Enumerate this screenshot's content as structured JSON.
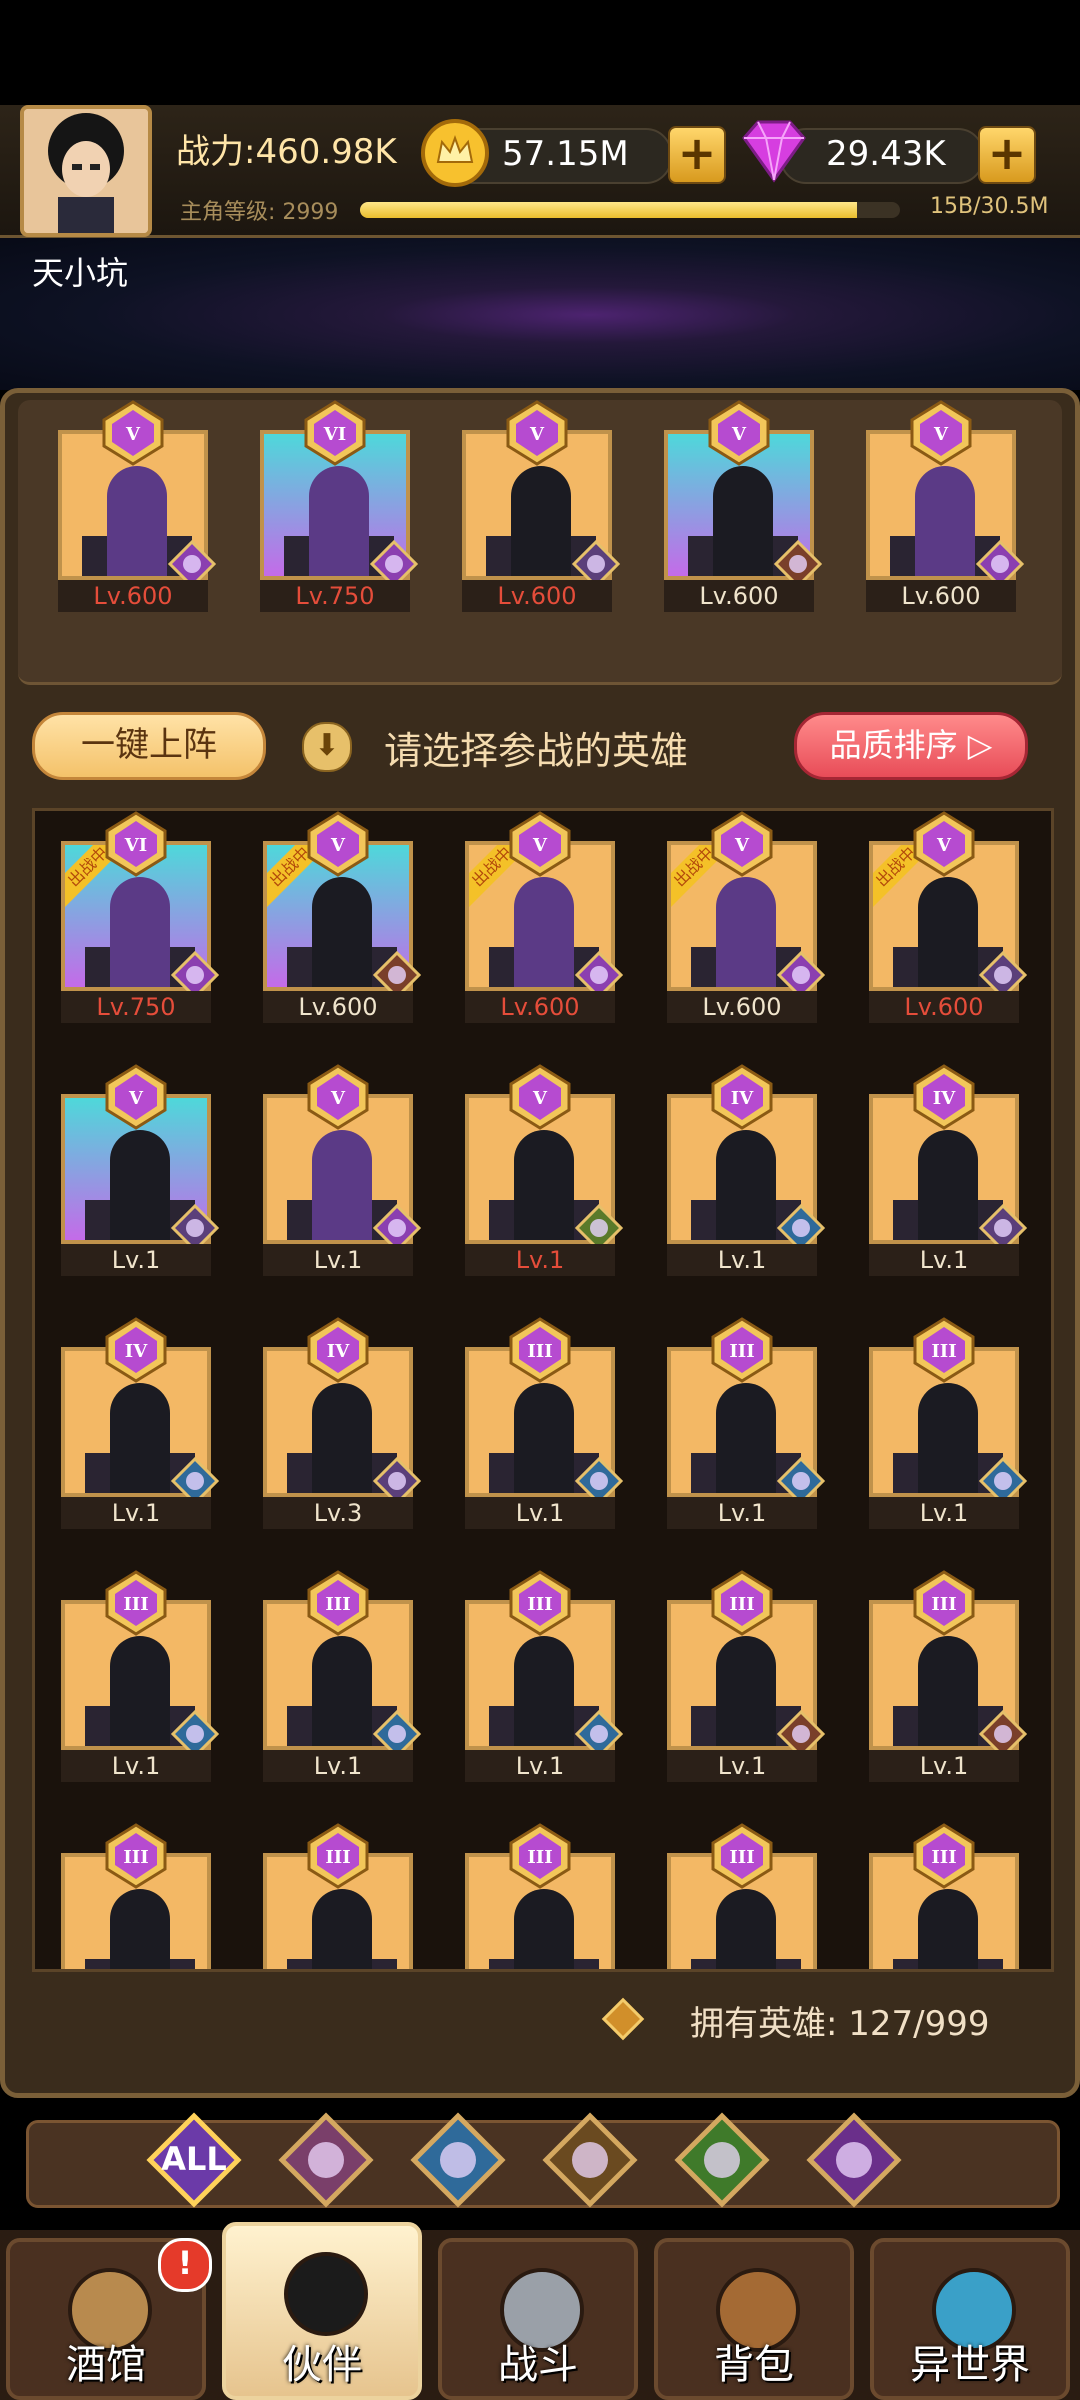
{
  "header": {
    "power": "战力:460.98K",
    "gold": "57.15M",
    "gems": "29.43K",
    "level_label": "主角等级: 2999",
    "level_progress_text": "15B/30.5M",
    "level_fill_fraction": 0.92,
    "player_name": "天小坑"
  },
  "team": [
    {
      "rank": "V",
      "level": "Lv.600",
      "level_color": "red",
      "bg": "gold",
      "faction": "demon"
    },
    {
      "rank": "VI",
      "level": "Lv.750",
      "level_color": "red",
      "bg": "teal",
      "faction": "demon"
    },
    {
      "rank": "V",
      "level": "Lv.600",
      "level_color": "red",
      "bg": "gold",
      "faction": "crown"
    },
    {
      "rank": "V",
      "level": "Lv.600",
      "level_color": "white",
      "bg": "teal",
      "faction": "lion"
    },
    {
      "rank": "V",
      "level": "Lv.600",
      "level_color": "white",
      "bg": "gold",
      "faction": "demon"
    }
  ],
  "actions": {
    "one_key": "一键上阵",
    "hint": "请选择参战的英雄",
    "sort": "品质排序"
  },
  "grid": [
    {
      "rank": "VI",
      "level": "Lv.750",
      "level_color": "red",
      "bg": "teal",
      "tag": "出战中",
      "faction": "demon"
    },
    {
      "rank": "V",
      "level": "Lv.600",
      "level_color": "white",
      "bg": "teal",
      "tag": "出战中",
      "faction": "lion"
    },
    {
      "rank": "V",
      "level": "Lv.600",
      "level_color": "red",
      "bg": "gold",
      "tag": "出战中",
      "faction": "demon"
    },
    {
      "rank": "V",
      "level": "Lv.600",
      "level_color": "white",
      "bg": "gold",
      "tag": "出战中",
      "faction": "demon"
    },
    {
      "rank": "V",
      "level": "Lv.600",
      "level_color": "red",
      "bg": "gold",
      "tag": "出战中",
      "faction": "crown"
    },
    {
      "rank": "V",
      "level": "Lv.1",
      "level_color": "white",
      "bg": "teal",
      "tag": "",
      "faction": "crown"
    },
    {
      "rank": "V",
      "level": "Lv.1",
      "level_color": "white",
      "bg": "gold",
      "tag": "",
      "faction": "demon"
    },
    {
      "rank": "V",
      "level": "Lv.1",
      "level_color": "red",
      "bg": "gold",
      "tag": "",
      "faction": "elf"
    },
    {
      "rank": "IV",
      "level": "Lv.1",
      "level_color": "white",
      "bg": "gold",
      "tag": "",
      "faction": "fish"
    },
    {
      "rank": "IV",
      "level": "Lv.1",
      "level_color": "white",
      "bg": "gold",
      "tag": "",
      "faction": "crown"
    },
    {
      "rank": "IV",
      "level": "Lv.1",
      "level_color": "white",
      "bg": "gold",
      "tag": "",
      "faction": "fish"
    },
    {
      "rank": "IV",
      "level": "Lv.3",
      "level_color": "white",
      "bg": "gold",
      "tag": "",
      "faction": "crown"
    },
    {
      "rank": "III",
      "level": "Lv.1",
      "level_color": "white",
      "bg": "gold",
      "tag": "",
      "faction": "fish"
    },
    {
      "rank": "III",
      "level": "Lv.1",
      "level_color": "white",
      "bg": "gold",
      "tag": "",
      "faction": "fish"
    },
    {
      "rank": "III",
      "level": "Lv.1",
      "level_color": "white",
      "bg": "gold",
      "tag": "",
      "faction": "fish"
    },
    {
      "rank": "III",
      "level": "Lv.1",
      "level_color": "white",
      "bg": "gold",
      "tag": "",
      "faction": "fish"
    },
    {
      "rank": "III",
      "level": "Lv.1",
      "level_color": "white",
      "bg": "gold",
      "tag": "",
      "faction": "fish"
    },
    {
      "rank": "III",
      "level": "Lv.1",
      "level_color": "white",
      "bg": "gold",
      "tag": "",
      "faction": "fish"
    },
    {
      "rank": "III",
      "level": "Lv.1",
      "level_color": "white",
      "bg": "gold",
      "tag": "",
      "faction": "lion"
    },
    {
      "rank": "III",
      "level": "Lv.1",
      "level_color": "white",
      "bg": "gold",
      "tag": "",
      "faction": "lion"
    },
    {
      "rank": "III",
      "level": "",
      "level_color": "white",
      "bg": "gold",
      "tag": "",
      "faction": ""
    },
    {
      "rank": "III",
      "level": "",
      "level_color": "white",
      "bg": "gold",
      "tag": "",
      "faction": ""
    },
    {
      "rank": "III",
      "level": "",
      "level_color": "white",
      "bg": "gold",
      "tag": "",
      "faction": ""
    },
    {
      "rank": "III",
      "level": "",
      "level_color": "white",
      "bg": "gold",
      "tag": "",
      "faction": ""
    },
    {
      "rank": "III",
      "level": "",
      "level_color": "white",
      "bg": "gold",
      "tag": "",
      "faction": ""
    }
  ],
  "owned": "拥有英雄: 127/999",
  "filters": [
    {
      "label": "ALL",
      "icon": "all-icon"
    },
    {
      "label": "",
      "icon": "crown-faction-icon"
    },
    {
      "label": "",
      "icon": "fish-faction-icon"
    },
    {
      "label": "",
      "icon": "lion-faction-icon"
    },
    {
      "label": "",
      "icon": "elf-faction-icon"
    },
    {
      "label": "",
      "icon": "demon-faction-icon"
    }
  ],
  "nav": [
    {
      "label": "酒馆",
      "icon": "beer-mug-icon"
    },
    {
      "label": "伙伴",
      "icon": "partner-avatar-icon"
    },
    {
      "label": "战斗",
      "icon": "crossed-swords-icon"
    },
    {
      "label": "背包",
      "icon": "treasure-chest-icon"
    },
    {
      "label": "异世界",
      "icon": "portal-icon"
    }
  ],
  "nav_alert": "!",
  "colors": {
    "panel": "#3a2c1c",
    "gold_card": "#f3b865",
    "teal_card": "#4ed8da",
    "red_level": "#e54d3a",
    "sort_button": "#e84c58"
  }
}
